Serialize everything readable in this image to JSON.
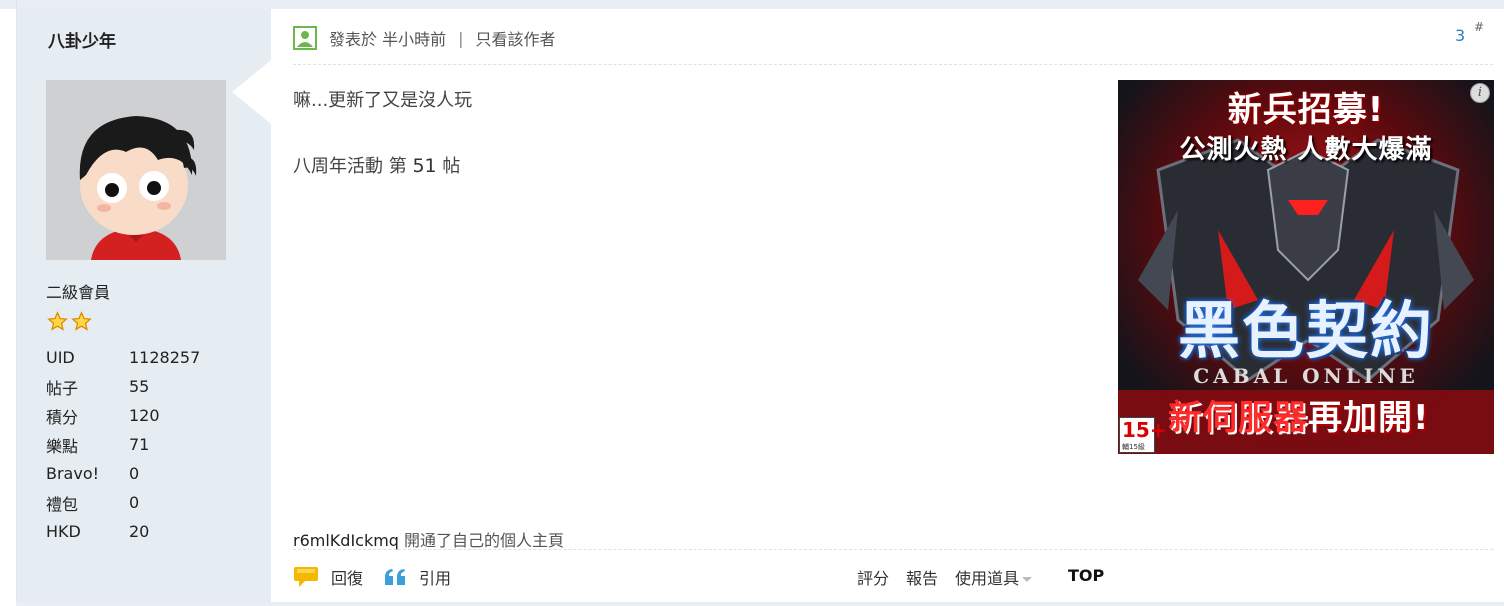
{
  "author": {
    "name": "八卦少年",
    "rank": "二級會員",
    "stars": 2,
    "stats": [
      {
        "key": "UID",
        "value": "1128257"
      },
      {
        "key": "帖子",
        "value": "55"
      },
      {
        "key": "積分",
        "value": "120"
      },
      {
        "key": "樂點",
        "value": "71"
      },
      {
        "key": "Bravo!",
        "value": "0"
      },
      {
        "key": "禮包",
        "value": "0"
      },
      {
        "key": "HKD",
        "value": "20"
      }
    ]
  },
  "post": {
    "posted_label": "發表於 半小時前",
    "separator": "|",
    "only_author_label": "只看該作者",
    "floor_number": "3",
    "floor_symbol": "#",
    "content_line1": "嘛...更新了又是沒人玩",
    "content_line2_prefix": "八周年活動 第",
    "content_line2_number": "51",
    "content_line2_suffix": "帖"
  },
  "ad": {
    "headline": "新兵招募!",
    "subline": "公測火熱 人數大爆滿",
    "game_title": "黑色契約",
    "game_subtitle": "CABAL ONLINE",
    "promo_part1": "新伺服器",
    "promo_part2": "再加開!",
    "rating": "15+",
    "rating_note": "輔15級",
    "info_icon_text": "i"
  },
  "activity": {
    "user": "r6mlKdIckmq",
    "text": " 開通了自己的個人主頁"
  },
  "footer": {
    "reply_label": "回復",
    "quote_label": "引用",
    "rate_label": "評分",
    "report_label": "報告",
    "tools_label": "使用道具",
    "top_label": "TOP"
  },
  "colors": {
    "sidebar_bg": "#e5edf2",
    "floor_link": "#2a7fb8",
    "online_icon": "#6ab84a"
  }
}
